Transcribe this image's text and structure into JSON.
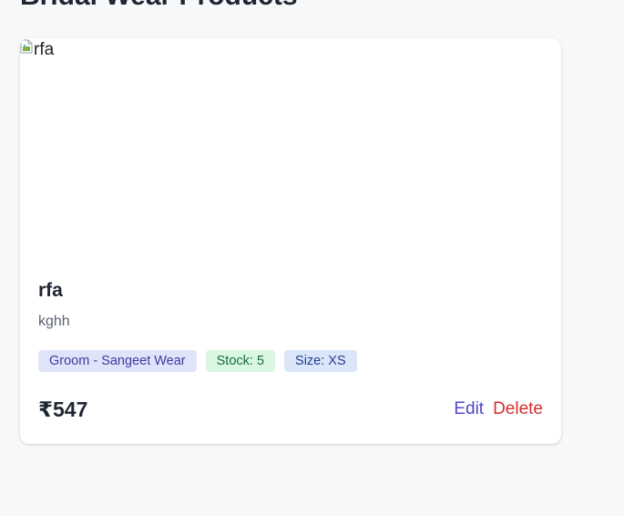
{
  "page": {
    "heading": "Bridal Wear Products"
  },
  "product": {
    "image_alt": "rfa",
    "name": "rfa",
    "description": "kghh",
    "tags": {
      "category": "Groom - Sangeet Wear",
      "stock": "Stock: 5",
      "size": "Size: XS"
    },
    "price": "₹547",
    "actions": {
      "edit_label": "Edit",
      "delete_label": "Delete"
    }
  },
  "colors": {
    "background": "#f7f8fa",
    "card": "#ffffff",
    "edit": "#4f46c8",
    "delete": "#d22f2f",
    "category_tag_bg": "#e0e4fb",
    "stock_tag_bg": "#d9f7e3",
    "size_tag_bg": "#dbe6fb"
  },
  "icons": {
    "broken_image": "broken-image-icon"
  }
}
